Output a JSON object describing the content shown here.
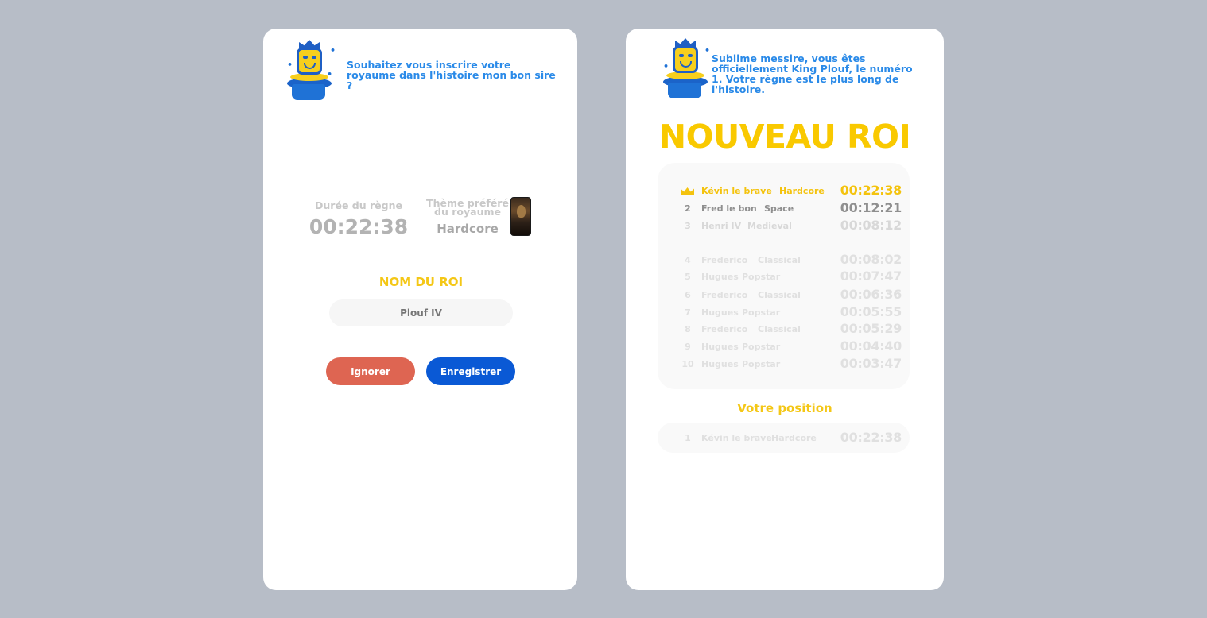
{
  "left_screen": {
    "prompt": "Souhaitez vous inscrire votre royaume dans l'histoire mon bon sire ?",
    "reign_label": "Durée du règne",
    "reign_value": "00:22:38",
    "theme_label": "Thème préféré du royaume",
    "theme_value": "Hardcore",
    "name_title": "NOM DU ROI",
    "name_placeholder": "Plouf IV",
    "name_value": "",
    "ignore_label": "Ignorer",
    "save_label": "Enregistrer"
  },
  "right_screen": {
    "message": "Sublime messire, vous êtes officiellement King Plouf, le numéro 1. Votre règne est le plus long de l'histoire.",
    "title": "NOUVEAU ROI",
    "leaderboard": [
      {
        "rank": "",
        "name": "Kévin le brave",
        "theme": "Hardcore",
        "time": "00:22:38",
        "icon": "crown-icon"
      },
      {
        "rank": "2",
        "name": "Fred le bon",
        "theme": "Space",
        "time": "00:12:21"
      },
      {
        "rank": "3",
        "name": "Henri IV",
        "theme": "Medieval",
        "time": "00:08:12"
      },
      {
        "rank": "4",
        "name": "Frederico",
        "theme": "Classical",
        "time": "00:08:02"
      },
      {
        "rank": "5",
        "name": "Hugues",
        "theme": "Popstar",
        "time": "00:07:47"
      },
      {
        "rank": "6",
        "name": "Frederico",
        "theme": "Classical",
        "time": "00:06:36"
      },
      {
        "rank": "7",
        "name": "Hugues",
        "theme": "Popstar",
        "time": "00:05:55"
      },
      {
        "rank": "8",
        "name": "Frederico",
        "theme": "Classical",
        "time": "00:05:29"
      },
      {
        "rank": "9",
        "name": "Hugues",
        "theme": "Popstar",
        "time": "00:04:40"
      },
      {
        "rank": "10",
        "name": "Hugues",
        "theme": "Popstar",
        "time": "00:03:47"
      }
    ],
    "position_title": "Votre position",
    "my_position": {
      "rank": "1",
      "name": "Kévin le brave",
      "theme": "Hardcore",
      "time": "00:22:38"
    }
  },
  "colors": {
    "background": "#b7bdc7",
    "accent_blue": "#2a8ae8",
    "accent_yellow": "#f4c716",
    "button_ignore": "#de6552",
    "button_save": "#0a59d5"
  }
}
